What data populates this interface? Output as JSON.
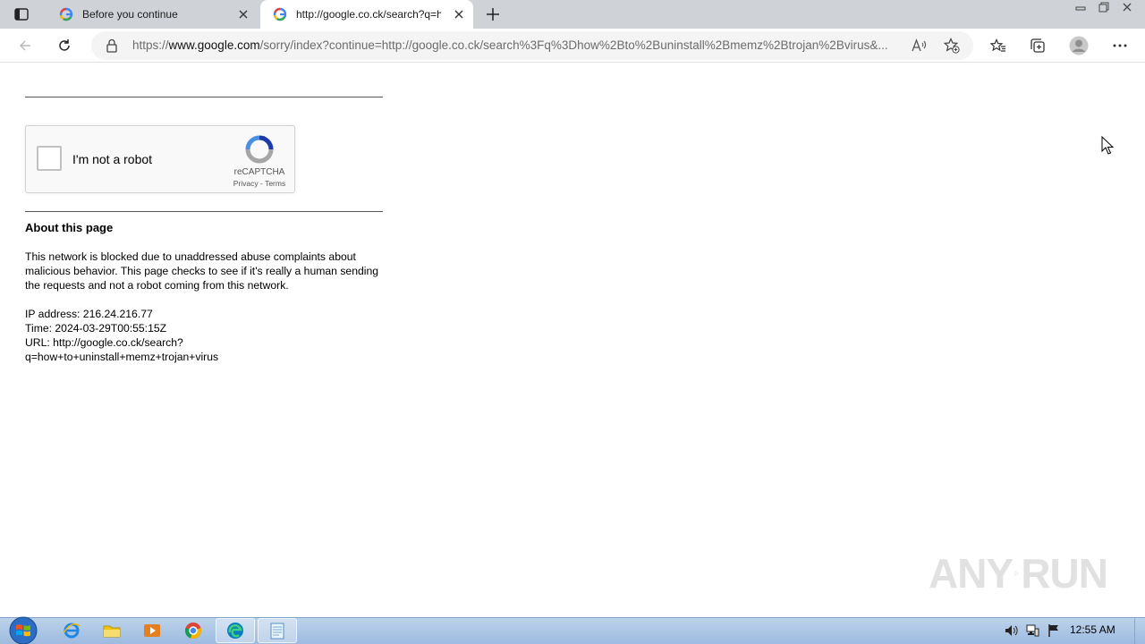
{
  "browser": {
    "tabs": [
      {
        "title": "Before you continue",
        "active": false
      },
      {
        "title": "http://google.co.ck/search?q=how+to+uninstall+memz+trojan+virus",
        "active": true
      }
    ],
    "address": {
      "scheme": "https://",
      "host": "www.google.com",
      "path": "/sorry/index?continue=http://google.co.ck/search%3Fq%3Dhow%2Bto%2Buninstall%2Bmemz%2Btrojan%2Bvirus&..."
    }
  },
  "captcha": {
    "label": "I'm not a robot",
    "brand": "reCAPTCHA",
    "links": "Privacy - Terms"
  },
  "about": {
    "title": "About this page",
    "body": "This network is blocked due to unaddressed abuse complaints about malicious behavior. This page checks to see if it's really a human sending the requests and not a robot coming from this network.",
    "ip": "IP address: 216.24.216.77",
    "time": "Time: 2024-03-29T00:55:15Z",
    "url_line1": "URL: http://google.co.ck/search?",
    "url_line2": "q=how+to+uninstall+memz+trojan+virus"
  },
  "watermark": {
    "left": "ANY",
    "right": "RUN"
  },
  "taskbar": {
    "clock": "12:55 AM"
  },
  "colors": {
    "tabstrip": "#cfd3d8",
    "taskbar": "#a9c4e4",
    "recaptcha_blue": "#1c3aa9"
  }
}
